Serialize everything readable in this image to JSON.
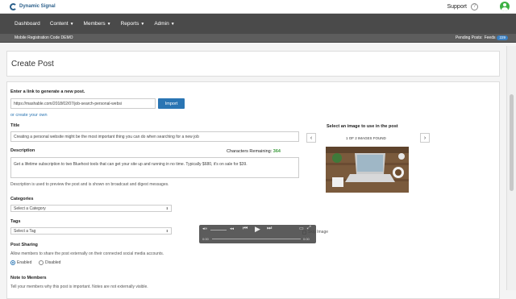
{
  "brand": {
    "name": "Dynamic Signal"
  },
  "topbar": {
    "support_label": "Support"
  },
  "nav": {
    "items": [
      {
        "label": "Dashboard",
        "dropdown": false
      },
      {
        "label": "Content",
        "dropdown": true
      },
      {
        "label": "Members",
        "dropdown": true
      },
      {
        "label": "Reports",
        "dropdown": true
      },
      {
        "label": "Admin",
        "dropdown": true
      }
    ]
  },
  "subbar": {
    "left_text": "Mobile Registration Code DEMO",
    "pending_label": "Pending Posts:",
    "feeds_label": "Feeds",
    "feeds_count": "229"
  },
  "page": {
    "title": "Create Post"
  },
  "form": {
    "link_label": "Enter a link to generate a new post.",
    "link_value": "https://mashable.com/2018/02/07/job-search-personal-websi",
    "import_label": "Import",
    "create_own_link": "or create your own",
    "title_label": "Title",
    "title_value": "Creating a personal website might be the most important thing you can do when searching for a new job",
    "description_label": "Description",
    "chars_label": "Characters Remaining:",
    "chars_remaining": "364",
    "description_value": "Get a lifetime subscription to two Bluehost tools that can get your site up and running in no time. Typically $680, it's on sale for $39.",
    "description_help": "Description is used to preview the post and is shown on broadcast and digest messages.",
    "categories_label": "Categories",
    "category_selected": "Select a Category",
    "tags_label": "Tags",
    "tag_selected": "Select a Tag",
    "sharing_label": "Post Sharing",
    "sharing_help": "Allow members to share the post externally on their connected social media accounts.",
    "sharing_enabled": "Enabled",
    "sharing_disabled": "Disabled",
    "note_label": "Note to Members",
    "note_help": "Tell your members why this post is important. Notes are not externally visible."
  },
  "image_picker": {
    "heading": "Select an image to use in the post",
    "count_text": "1 OF 2 IMAGES FOUND",
    "prev_icon": "chevron-left-icon",
    "next_icon": "chevron-right-icon",
    "skip_label": "Skip Image"
  },
  "player": {
    "time_elapsed": "0:00",
    "time_total": "0:00"
  },
  "colors": {
    "nav_bg": "#4a4a4a",
    "accent": "#2a75b3",
    "chars_green": "#3a9a3a",
    "avatar_green": "#3cb043"
  }
}
